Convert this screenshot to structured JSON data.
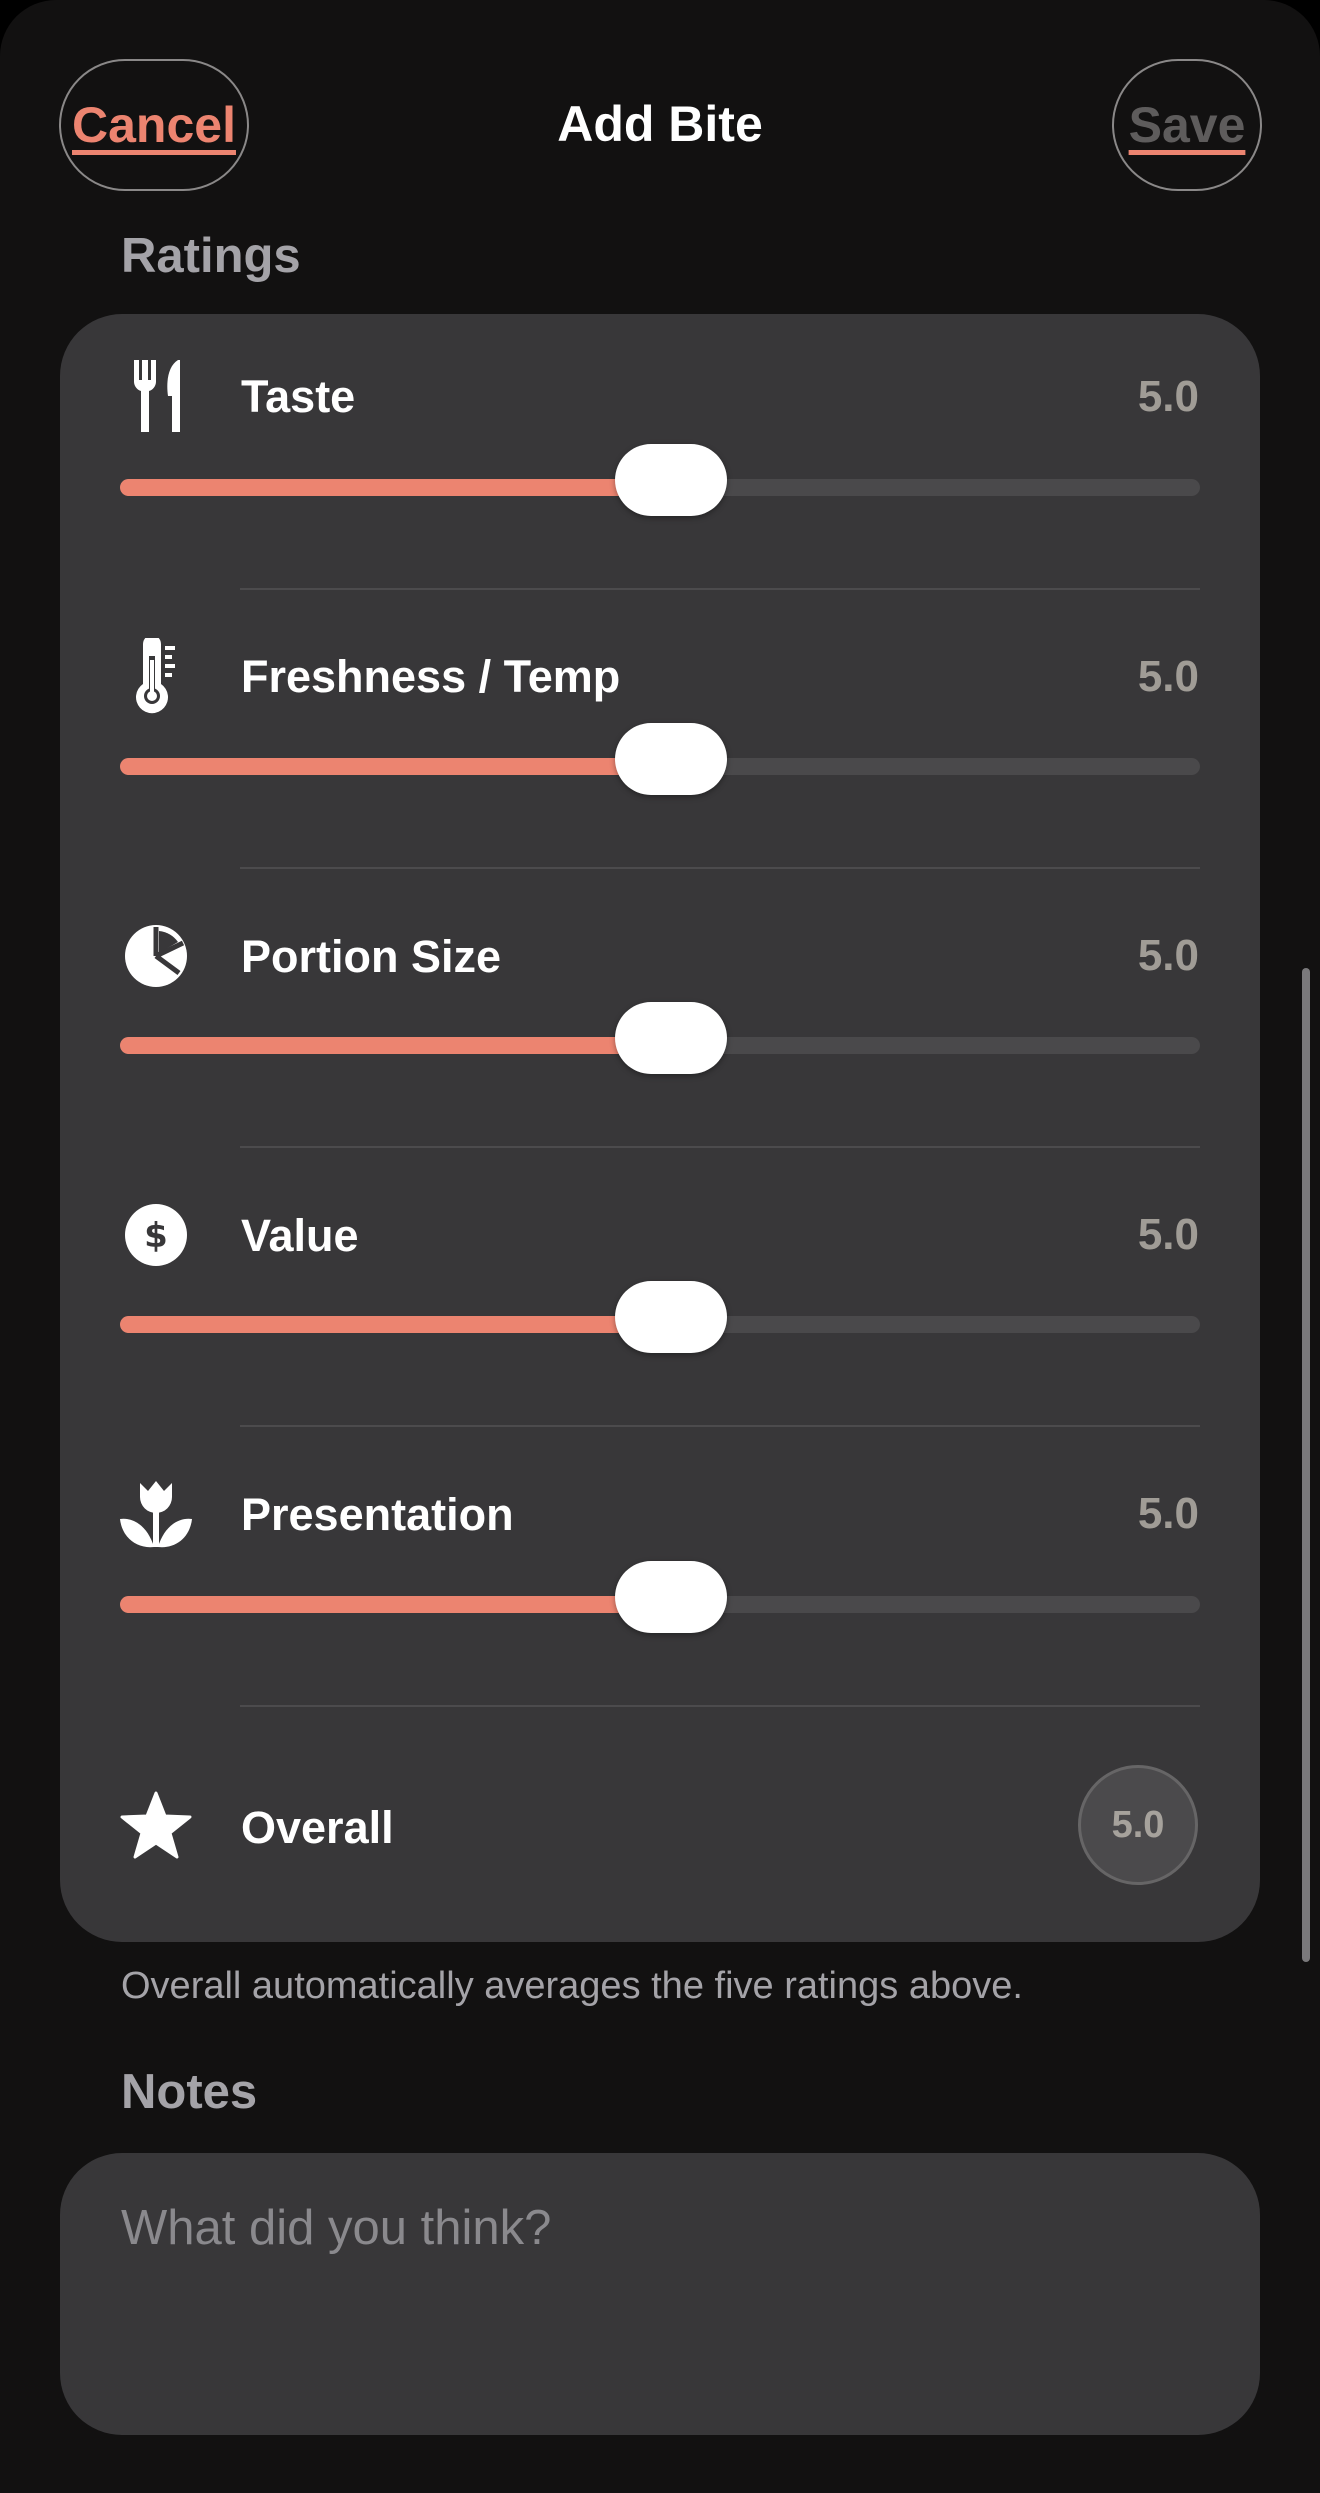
{
  "nav": {
    "cancel_label": "Cancel",
    "title": "Add Bite",
    "save_label": "Save"
  },
  "sections": {
    "ratings_header": "Ratings",
    "notes_header": "Notes"
  },
  "ratings": [
    {
      "label": "Taste",
      "value": "5.0",
      "icon": "fork-knife-icon",
      "level": 0.5
    },
    {
      "label": "Freshness / Temp",
      "value": "5.0",
      "icon": "thermometer-icon",
      "level": 0.5
    },
    {
      "label": "Portion Size",
      "value": "5.0",
      "icon": "pie-chart-icon",
      "level": 0.5
    },
    {
      "label": "Value",
      "value": "5.0",
      "icon": "dollar-icon",
      "level": 0.5
    },
    {
      "label": "Presentation",
      "value": "5.0",
      "icon": "tulip-icon",
      "level": 0.5
    }
  ],
  "overall": {
    "label": "Overall",
    "value": "5.0",
    "icon": "star-icon"
  },
  "footnote": "Overall automatically averages the five ratings above.",
  "notes": {
    "placeholder": "What did you think?"
  },
  "colors": {
    "accent": "#ec8470",
    "background": "#121111",
    "card": "#383739",
    "secondary_text": "#a4a3a8"
  }
}
